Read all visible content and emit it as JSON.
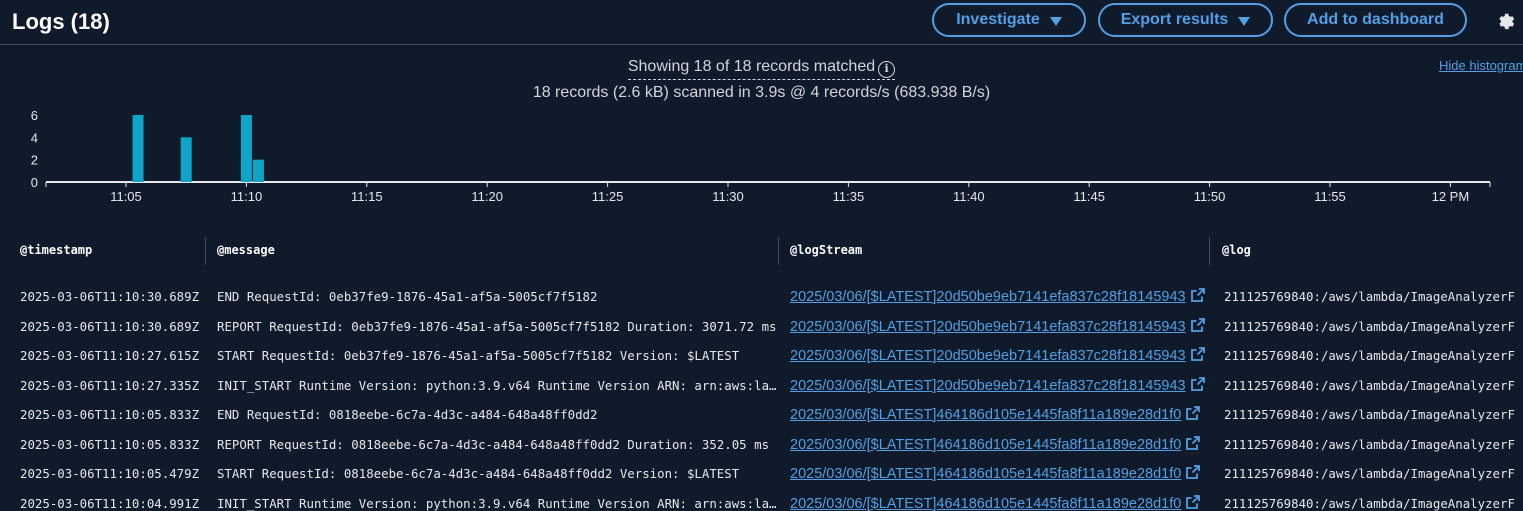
{
  "header": {
    "title": "Logs (18)",
    "investigate_label": "Investigate",
    "export_label": "Export results",
    "dashboard_label": "Add to dashboard"
  },
  "summary": {
    "matched": "Showing 18 of 18 records matched",
    "scanned": "18 records (2.6 kB) scanned in 3.9s @ 4 records/s (683.938 B/s)",
    "hide_histogram": "Hide histogram"
  },
  "chart_data": {
    "type": "bar",
    "x": [
      "11:05:30",
      "11:07:30",
      "11:10:00",
      "11:10:30"
    ],
    "values": [
      6,
      4,
      6,
      2
    ],
    "x_ticks": [
      "11:05",
      "11:10",
      "11:15",
      "11:20",
      "11:25",
      "11:30",
      "11:35",
      "11:40",
      "11:45",
      "11:50",
      "11:55",
      "12 PM"
    ],
    "y_ticks": [
      "0",
      "2",
      "4",
      "6"
    ],
    "ylim": [
      0,
      6
    ],
    "grid": false,
    "color": "#0ea5c9"
  },
  "columns": [
    "@timestamp",
    "@message",
    "@logStream",
    "@log"
  ],
  "rows": [
    {
      "timestamp": "2025-03-06T11:10:30.689Z",
      "message": "END RequestId: 0eb37fe9-1876-45a1-af5a-5005cf7f5182",
      "logstream": "2025/03/06/[$LATEST]20d50be9eb7141efa837c28f18145943",
      "log": "211125769840:/aws/lambda/ImageAnalyzerF"
    },
    {
      "timestamp": "2025-03-06T11:10:30.689Z",
      "message": "REPORT RequestId: 0eb37fe9-1876-45a1-af5a-5005cf7f5182 Duration: 3071.72 ms",
      "logstream": "2025/03/06/[$LATEST]20d50be9eb7141efa837c28f18145943",
      "log": "211125769840:/aws/lambda/ImageAnalyzerF"
    },
    {
      "timestamp": "2025-03-06T11:10:27.615Z",
      "message": "START RequestId: 0eb37fe9-1876-45a1-af5a-5005cf7f5182 Version: $LATEST",
      "logstream": "2025/03/06/[$LATEST]20d50be9eb7141efa837c28f18145943",
      "log": "211125769840:/aws/lambda/ImageAnalyzerF"
    },
    {
      "timestamp": "2025-03-06T11:10:27.335Z",
      "message": "INIT_START Runtime Version: python:3.9.v64 Runtime Version ARN: arn:aws:lambda",
      "logstream": "2025/03/06/[$LATEST]20d50be9eb7141efa837c28f18145943",
      "log": "211125769840:/aws/lambda/ImageAnalyzerF"
    },
    {
      "timestamp": "2025-03-06T11:10:05.833Z",
      "message": "END RequestId: 0818eebe-6c7a-4d3c-a484-648a48ff0dd2",
      "logstream": "2025/03/06/[$LATEST]464186d105e1445fa8f11a189e28d1f0",
      "log": "211125769840:/aws/lambda/ImageAnalyzerF"
    },
    {
      "timestamp": "2025-03-06T11:10:05.833Z",
      "message": "REPORT RequestId: 0818eebe-6c7a-4d3c-a484-648a48ff0dd2 Duration: 352.05 ms",
      "logstream": "2025/03/06/[$LATEST]464186d105e1445fa8f11a189e28d1f0",
      "log": "211125769840:/aws/lambda/ImageAnalyzerF"
    },
    {
      "timestamp": "2025-03-06T11:10:05.479Z",
      "message": "START RequestId: 0818eebe-6c7a-4d3c-a484-648a48ff0dd2 Version: $LATEST",
      "logstream": "2025/03/06/[$LATEST]464186d105e1445fa8f11a189e28d1f0",
      "log": "211125769840:/aws/lambda/ImageAnalyzerF"
    },
    {
      "timestamp": "2025-03-06T11:10:04.991Z",
      "message": "INIT_START Runtime Version: python:3.9.v64 Runtime Version ARN: arn:aws:lambda",
      "logstream": "2025/03/06/[$LATEST]464186d105e1445fa8f11a189e28d1f0",
      "log": "211125769840:/aws/lambda/ImageAnalyzerF"
    }
  ]
}
